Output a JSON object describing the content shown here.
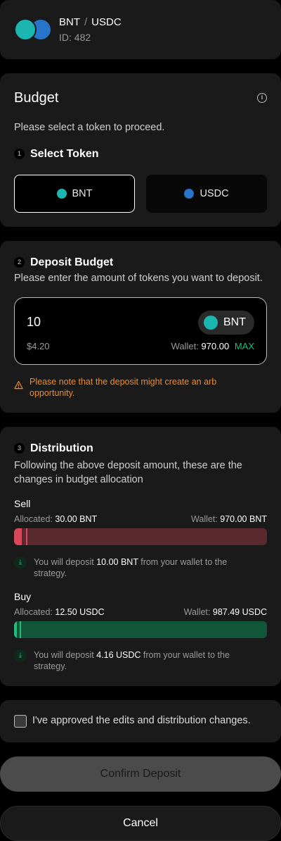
{
  "header": {
    "base_token": "BNT",
    "separator": "/",
    "quote_token": "USDC",
    "id_label": "ID: 482"
  },
  "budget": {
    "title": "Budget",
    "subtitle": "Please select a token to proceed.",
    "step1_number": "1",
    "step1_title": "Select Token",
    "tokens": [
      {
        "label": "BNT",
        "selected": true
      },
      {
        "label": "USDC",
        "selected": false
      }
    ]
  },
  "deposit": {
    "step_number": "2",
    "title": "Deposit Budget",
    "subtitle": "Please enter the amount of tokens you want to deposit.",
    "amount": "10",
    "token": "BNT",
    "usd_value": "$4.20",
    "wallet_label": "Wallet:",
    "wallet_value": "970.00",
    "max_label": "MAX",
    "warning": "Please note that the deposit might create an arb opportunity."
  },
  "distribution": {
    "step_number": "3",
    "title": "Distribution",
    "subtitle": "Following the above deposit amount, these are the changes in budget allocation",
    "sell": {
      "label": "Sell",
      "allocated_label": "Allocated:",
      "allocated_value": "30.00 BNT",
      "wallet_label": "Wallet:",
      "wallet_value": "970.00 BNT",
      "allocated_fraction": 0.03,
      "note_prefix": "You will deposit",
      "note_amount": "10.00 BNT",
      "note_suffix": "from your wallet to the strategy."
    },
    "buy": {
      "label": "Buy",
      "allocated_label": "Allocated:",
      "allocated_value": "12.50 USDC",
      "wallet_label": "Wallet:",
      "wallet_value": "987.49 USDC",
      "allocated_fraction": 0.012,
      "note_prefix": "You will deposit",
      "note_amount": "4.16 USDC",
      "note_suffix": "from your wallet to the strategy."
    }
  },
  "approval": {
    "checked": false,
    "label": "I've approved the edits and distribution changes."
  },
  "actions": {
    "confirm_label": "Confirm Deposit",
    "cancel_label": "Cancel"
  },
  "colors": {
    "sell_bar_bg": "#5a2a30",
    "sell_bar_fill": "#d9485a",
    "buy_bar_bg": "#12573a",
    "buy_bar_fill": "#1fbf7a",
    "warning": "#f08a24",
    "accent_green": "#1fbf7a"
  }
}
